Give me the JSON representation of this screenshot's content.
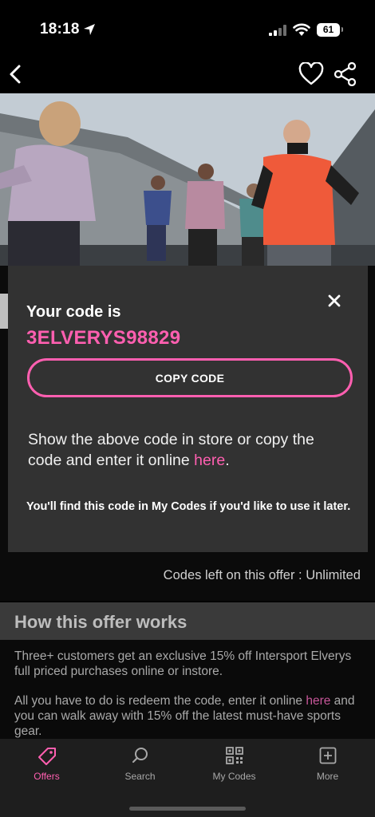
{
  "status_bar": {
    "time": "18:18",
    "battery": "61"
  },
  "nav": {
    "back_icon": "chevron-left-icon",
    "favorite_icon": "heart-icon",
    "share_icon": "share-icon"
  },
  "modal": {
    "title": "Your code is",
    "code": "3ELVERYS98829",
    "copy_label": "COPY CODE",
    "instructions_text": "Show the above code in store or copy the code and enter it online ",
    "instructions_link": "here",
    "instructions_end": ".",
    "note": "You'll find this code in My Codes if you'd like to use it later."
  },
  "codes_left": "Codes left on this offer : Unlimited",
  "how": {
    "title": "How this offer works",
    "para1": "Three+ customers get an exclusive 15% off Intersport Elverys full priced purchases online or instore.",
    "para2_start": "All you have to do is redeem the code, enter it online ",
    "para2_link": "here",
    "para2_end": " and you can walk away with 15% off the latest must-have sports gear."
  },
  "tabs": [
    {
      "label": "Offers",
      "icon": "tag-icon",
      "active": true
    },
    {
      "label": "Search",
      "icon": "search-icon",
      "active": false
    },
    {
      "label": "My Codes",
      "icon": "qr-code-icon",
      "active": false
    },
    {
      "label": "More",
      "icon": "plus-square-icon",
      "active": false
    }
  ],
  "colors": {
    "accent": "#ff5fb0",
    "modal_bg": "#323232",
    "tab_bar_bg": "#1e1e1e"
  }
}
